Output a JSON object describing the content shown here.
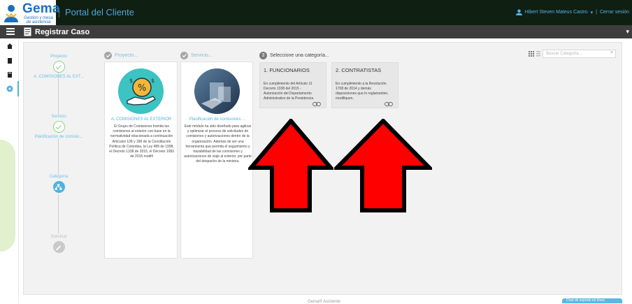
{
  "header": {
    "logo_title": "Gema",
    "logo_subtitle": "Gestión y mesa de asistencia",
    "portal_title": "Portal del Cliente",
    "user_name": "Hibert Steven Mateus Castro",
    "logout_label": "Cerrar sesión"
  },
  "subbar": {
    "title": "Registrar Caso"
  },
  "stepper": {
    "steps": [
      {
        "label": "Proyecto",
        "value": "A. COMISIONES AL EXT..."
      },
      {
        "label": "Servicio",
        "value": "Planificación de comisio..."
      },
      {
        "label": "Categoría",
        "value": ""
      },
      {
        "label": "Solicitud",
        "value": ""
      }
    ]
  },
  "columns": {
    "project_head": "Proyecto...",
    "service_head": "Servicio...",
    "category_head": "Seleccione una categoría...",
    "category_step_number": "3"
  },
  "project_card": {
    "title": "A. COMISIONES AL EXTERIOR",
    "description": "El Grupo de Comisiones tramita las comisiones al exterior con base en la normatividad relacionada a continuación Artículos 128 y 189 de la Constitución Política de Colombia, la Ley 489 de 1998, el Decreto 1338 de 2015, el Decreto 1083 de 2015 modifi"
  },
  "service_card": {
    "title": "Planificación de comisiones ...",
    "description": "Este módulo ha sido diseñado para agilizar y optimizar el proceso de solicitudes de comisiones y autorizaciones dentro de la organización. Además de ser una herramienta que permita el seguimiento y trazabilidad de las comisiones y autorizaciones de viaje al exterior, por parte del despacho de la ministra."
  },
  "categories": [
    {
      "title": "1. FUNCIONARIOS",
      "description": "En cumplimiento del Artículo 11 Decreto 1338 del 2015 - Autorización del Departamento Administrativo de la Presidencia"
    },
    {
      "title": "2. CONTRATISTAS",
      "description": "En cumplimiento a la Resolución 1708 de 2014 y demás disposiciones que lo reglamenten, modifiquen,"
    }
  ],
  "search": {
    "placeholder": "Buscar Categoría..."
  },
  "footer": {
    "text": "Gema® Asistente",
    "button_label": "Chat de soporte en línea"
  },
  "colors": {
    "header_bg": "#0f1f12",
    "subbar_bg": "#3d3d3d",
    "accent_blue": "#4fb3e0",
    "step_green": "#8fd38a",
    "arrow_red": "#ff0000"
  }
}
